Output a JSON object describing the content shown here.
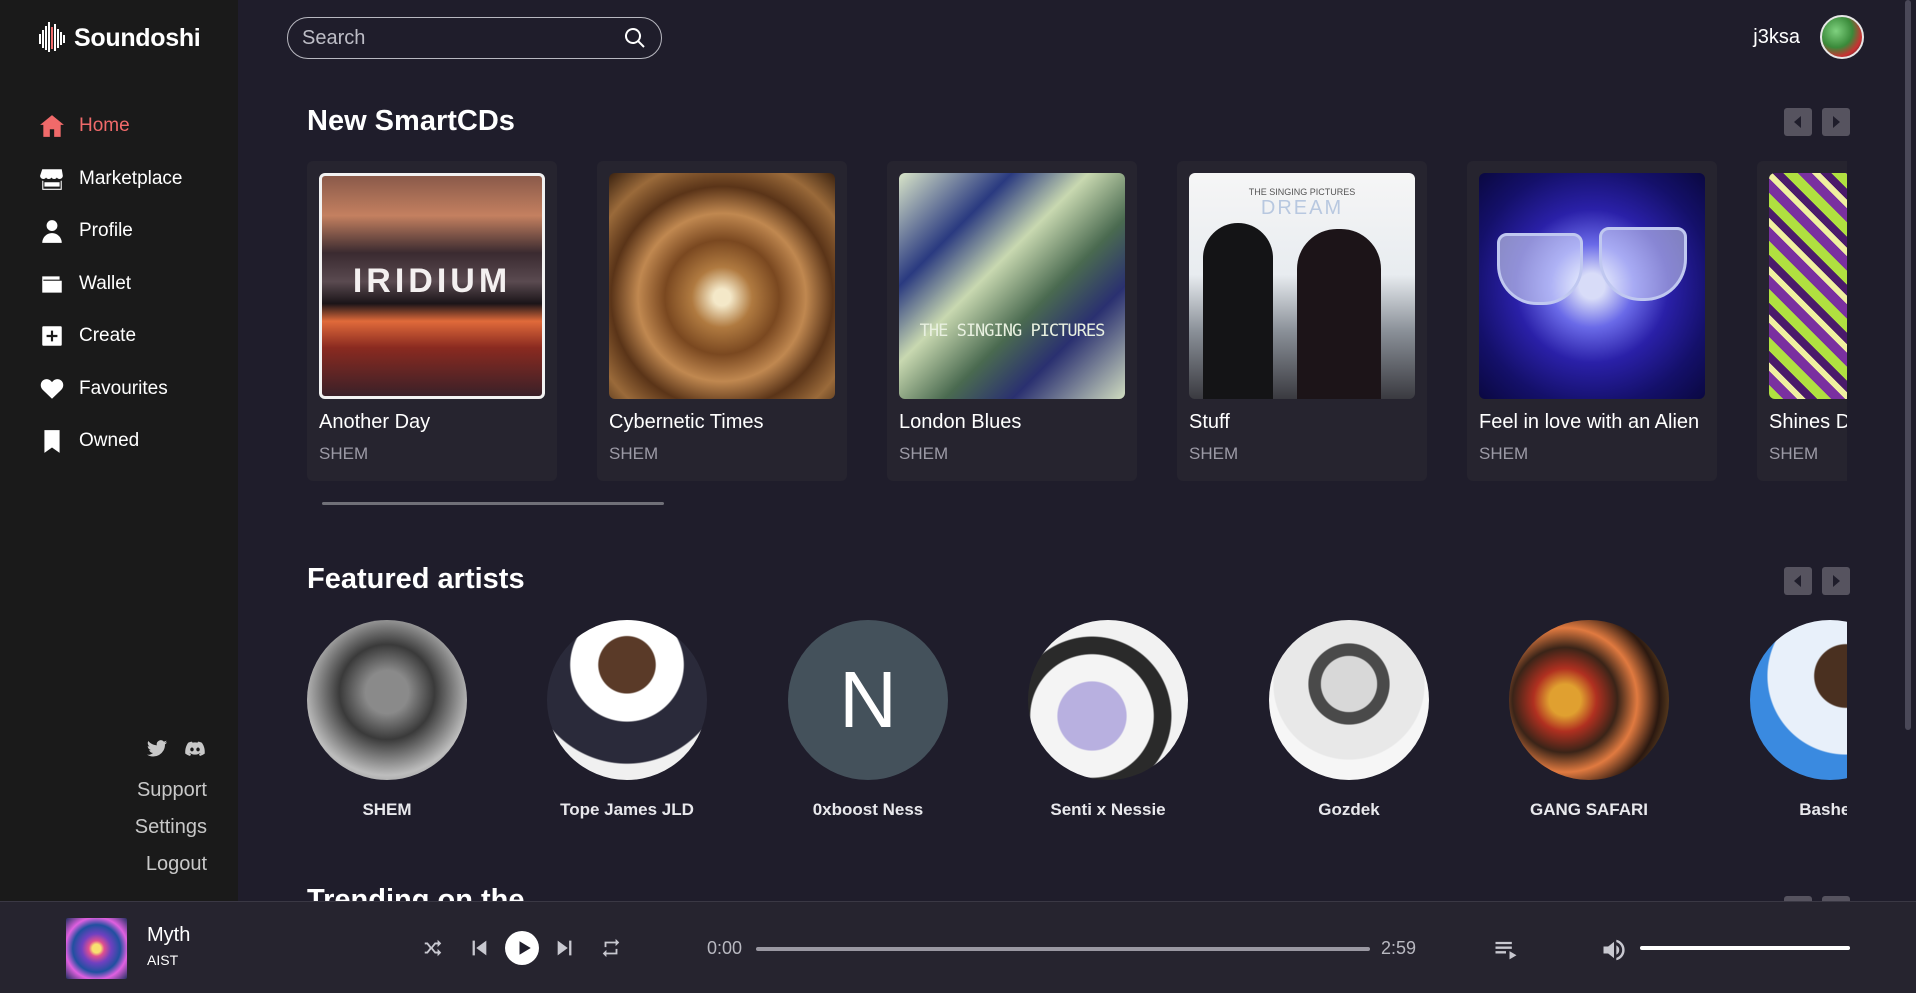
{
  "app": {
    "name": "Soundoshi"
  },
  "search": {
    "placeholder": "Search",
    "value": ""
  },
  "user": {
    "username": "j3ksa"
  },
  "sidebar": {
    "items": [
      {
        "label": "Home",
        "icon": "home-icon",
        "active": true
      },
      {
        "label": "Marketplace",
        "icon": "store-icon"
      },
      {
        "label": "Profile",
        "icon": "user-icon"
      },
      {
        "label": "Wallet",
        "icon": "wallet-icon"
      },
      {
        "label": "Create",
        "icon": "plus-square-icon"
      },
      {
        "label": "Favourites",
        "icon": "heart-icon"
      },
      {
        "label": "Owned",
        "icon": "bookmark-icon"
      }
    ],
    "social": [
      "twitter-icon",
      "discord-icon"
    ],
    "links": {
      "support": "Support",
      "settings": "Settings",
      "logout": "Logout"
    }
  },
  "sections": {
    "smartcds": {
      "title": "New SmartCDs",
      "cards": [
        {
          "title": "Another Day",
          "artist": "SHEM",
          "cover_text": "IRIDIUM"
        },
        {
          "title": "Cybernetic Times",
          "artist": "SHEM"
        },
        {
          "title": "London Blues",
          "artist": "SHEM",
          "cover_text": "THE SINGING PICTURES"
        },
        {
          "title": "Stuff",
          "artist": "SHEM",
          "cover_text": "THE SINGING PICTURES",
          "cover_text_2": "DREAM"
        },
        {
          "title": "Feel in love with an Alien",
          "artist": "SHEM"
        },
        {
          "title": "Shines D",
          "artist": "SHEM"
        }
      ]
    },
    "artists": {
      "title": "Featured artists",
      "items": [
        {
          "name": "SHEM"
        },
        {
          "name": "Tope James JLD"
        },
        {
          "name": "0xboost Ness",
          "initial": "N"
        },
        {
          "name": "Senti x Nessie"
        },
        {
          "name": "Gozdek"
        },
        {
          "name": "GANG SAFARI"
        },
        {
          "name": "Basheg"
        }
      ]
    },
    "next": {
      "title": "Trending on the Market"
    }
  },
  "player": {
    "title": "Myth",
    "artist": "AIST",
    "current_time": "0:00",
    "duration": "2:59",
    "progress": 0,
    "volume": 1.0
  },
  "colors": {
    "accent": "#f06a6a",
    "background": "#1f1d2b",
    "sidebar": "#1a1a1a",
    "card": "#26242f"
  }
}
